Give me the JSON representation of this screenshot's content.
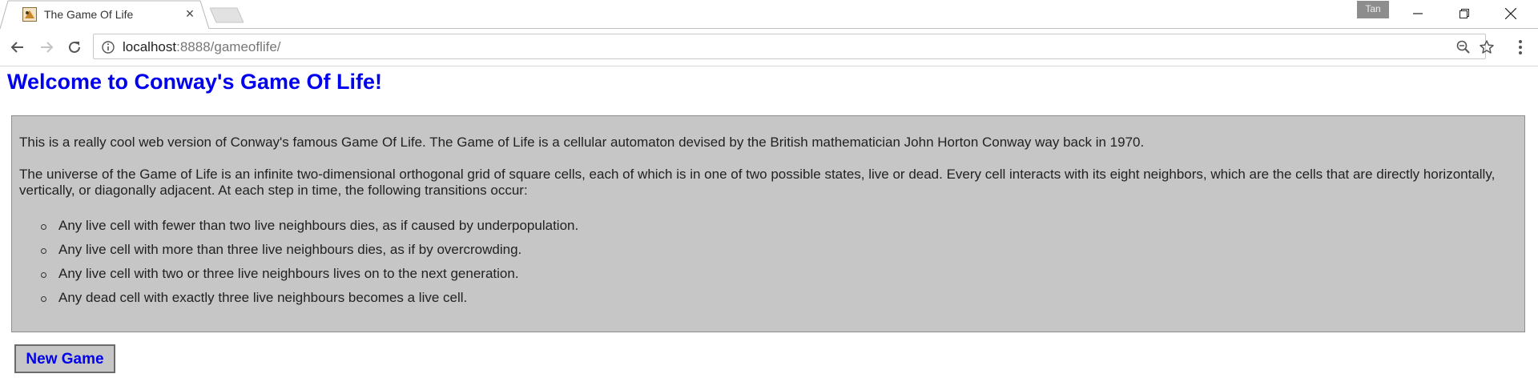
{
  "browser": {
    "tab": {
      "title": "The Game Of Life",
      "close_glyph": "×",
      "favicon": "game-of-life-favicon"
    },
    "profile_name": "Tan",
    "window_controls": [
      "minimize-icon",
      "restore-icon",
      "close-icon"
    ],
    "address_bar": {
      "host": "localhost",
      "path": ":8888/gameoflife/"
    },
    "icons": [
      "back-arrow-icon",
      "forward-arrow-icon",
      "reload-icon",
      "info-icon",
      "zoom-out-icon",
      "star-icon",
      "kebab-menu-icon"
    ]
  },
  "page": {
    "title": "Welcome to Conway's Game Of Life!",
    "intro": "This is a really cool web version of Conway's famous Game Of Life. The Game of Life is a cellular automaton devised by the British mathematician John Horton Conway way back in 1970.",
    "description": "The universe of the Game of Life is an infinite two-dimensional orthogonal grid of square cells, each of which is in one of two possible states, live or dead. Every cell interacts with its eight neighbors, which are the cells that are directly horizontally, vertically, or diagonally adjacent. At each step in time, the following transitions occur:",
    "rules": [
      "Any live cell with fewer than two live neighbours dies, as if caused by underpopulation.",
      "Any live cell with more than three live neighbours dies, as if by overcrowding.",
      "Any live cell with two or three live neighbours lives on to the next generation.",
      "Any dead cell with exactly three live neighbours becomes a live cell."
    ],
    "new_game_label": "New Game"
  },
  "colors": {
    "title": "#0000ee",
    "box_background": "#c6c6c6",
    "button_text": "#0000ee"
  }
}
